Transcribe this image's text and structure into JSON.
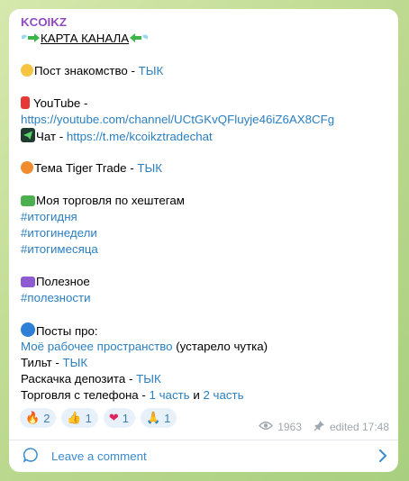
{
  "channel": {
    "name": "KCOIKZ"
  },
  "message": {
    "title": "КАРТА КАНАЛА",
    "post_intro": {
      "label": "Пост знакомство - ",
      "link": "ТЫК"
    },
    "youtube": {
      "label": "YouTube -",
      "url": "https://youtube.com/channel/UCtGKvQFluyje46iZ6AX8CFg"
    },
    "chat": {
      "label": "Чат - ",
      "url": "https://t.me/kcoikztradechat"
    },
    "tiger": {
      "label": "Тема Tiger Trade - ",
      "link": "ТЫК"
    },
    "trading": {
      "label": "Моя торговля по хештегам",
      "tags": [
        "#итогидня",
        "#итогинедели",
        "#итогимесяца"
      ]
    },
    "useful": {
      "label": "Полезное",
      "tag": "#полезности"
    },
    "posts_about": {
      "label": "Посты про:",
      "workspace_link": "Моё рабочее пространство",
      "workspace_note": " (устарело чутка)",
      "tilt_label": "Тильт - ",
      "tilt_link": "ТЫК",
      "deposit_label": "Раскачка депозита - ",
      "deposit_link": "ТЫК",
      "phone_label": "Торговля с телефона - ",
      "phone_part1": "1 часть",
      "phone_and": " и ",
      "phone_part2": "2 часть"
    }
  },
  "reactions": [
    {
      "emoji": "🔥",
      "count": "2"
    },
    {
      "emoji": "👍",
      "count": "1"
    },
    {
      "emoji": "❤",
      "count": "1"
    },
    {
      "emoji": "🙏",
      "count": "1"
    }
  ],
  "meta": {
    "views": "1963",
    "edited": "edited 17:48"
  },
  "comment": {
    "label": "Leave a comment"
  },
  "colors": {
    "accent": "#2b7fc0",
    "channel_name": "#8f4bbf",
    "background": "#cfe3a8"
  }
}
